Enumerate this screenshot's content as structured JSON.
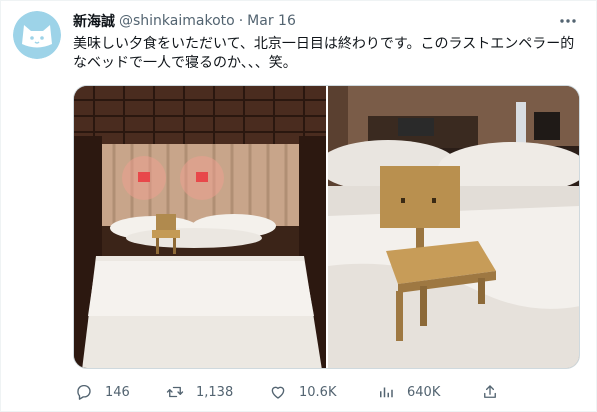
{
  "tweet": {
    "author_name": "新海誠",
    "handle": "@shinkaimakoto",
    "separator": "·",
    "date": "Mar 16",
    "text": "美味しい夕食をいただいて、北京一日目は終わりです。このラストエンペラー的なベッドで一人で寝るのか、、、笑。"
  },
  "actions": {
    "reply_count": "146",
    "retweet_count": "1,138",
    "like_count": "10.6K",
    "view_count": "640K"
  },
  "icons": {
    "avatar": "cat-face-avatar",
    "more": "more-dots-icon",
    "reply": "reply-icon",
    "retweet": "retweet-icon",
    "like": "heart-icon",
    "views": "views-icon",
    "share": "share-icon"
  },
  "colors": {
    "text": "#0f1419",
    "secondary": "#536471",
    "avatar_bg": "#9dd3e8"
  }
}
